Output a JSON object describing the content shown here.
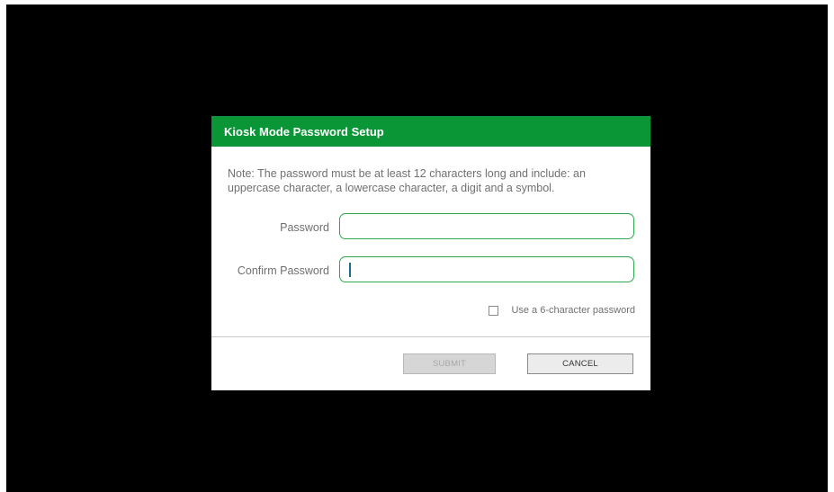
{
  "dialog": {
    "title": "Kiosk Mode Password Setup",
    "note": "Note: The password must be at least 12 characters long and include: an uppercase character, a lowercase character, a digit and a symbol.",
    "password_label": "Password",
    "password_value": "",
    "confirm_label": "Confirm Password",
    "confirm_value": "",
    "checkbox_label": "Use a 6-character password",
    "checkbox_checked": false,
    "submit_label": "SUBMIT",
    "submit_enabled": false,
    "cancel_label": "CANCEL"
  },
  "colors": {
    "header": "#0a9637",
    "input_border": "#2ea84f",
    "background": "#000000"
  }
}
